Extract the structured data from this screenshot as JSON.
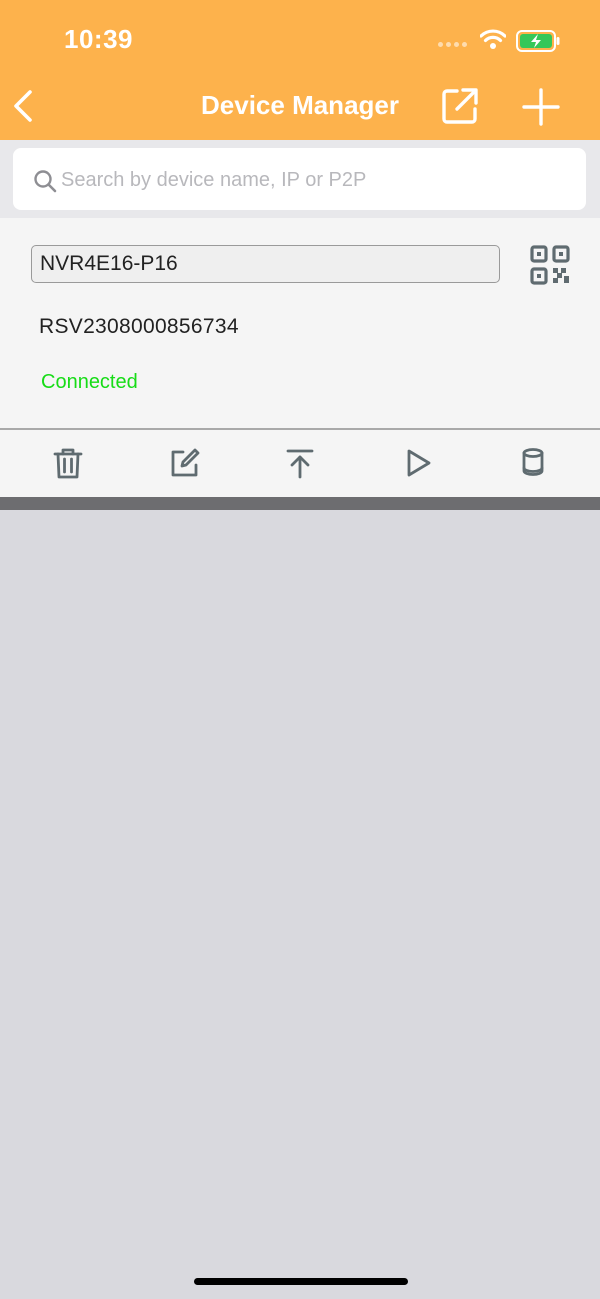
{
  "status_bar": {
    "time": "10:39"
  },
  "nav": {
    "title": "Device Manager",
    "back_icon": "chevron-left-icon",
    "share_icon": "share-external-icon",
    "add_icon": "plus-icon"
  },
  "search": {
    "placeholder": "Search by device name, IP or P2P",
    "value": ""
  },
  "device": {
    "name": "NVR4E16-P16",
    "serial": "RSV2308000856734",
    "status": "Connected",
    "status_color": "#17dc17"
  },
  "actions": [
    {
      "icon": "trash-icon"
    },
    {
      "icon": "edit-icon"
    },
    {
      "icon": "move-to-top-icon"
    },
    {
      "icon": "play-icon"
    },
    {
      "icon": "storage-icon"
    }
  ],
  "colors": {
    "header": "#fdb24c",
    "background": "#d9d9de",
    "icon": "#5f6b70"
  }
}
